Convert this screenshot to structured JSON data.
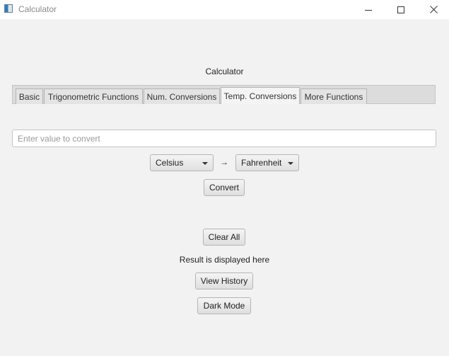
{
  "window": {
    "title": "Calculator",
    "controls": {
      "minimize_icon": "minimize-icon",
      "maximize_icon": "maximize-icon",
      "close_icon": "close-icon"
    }
  },
  "heading": "Calculator",
  "tabs": [
    {
      "label": "Basic",
      "active": false
    },
    {
      "label": "Trigonometric Functions",
      "active": false
    },
    {
      "label": "Num. Conversions",
      "active": false
    },
    {
      "label": "Temp. Conversions",
      "active": true
    },
    {
      "label": "More Functions",
      "active": false
    }
  ],
  "converter": {
    "input_value": "",
    "input_placeholder": "Enter value to convert",
    "from_unit": "Celsius",
    "arrow": "→",
    "to_unit": "Fahrenheit",
    "convert_label": "Convert"
  },
  "actions": {
    "clear_label": "Clear All",
    "result_text": "Result is displayed here",
    "history_label": "View History",
    "dark_mode_label": "Dark Mode"
  }
}
